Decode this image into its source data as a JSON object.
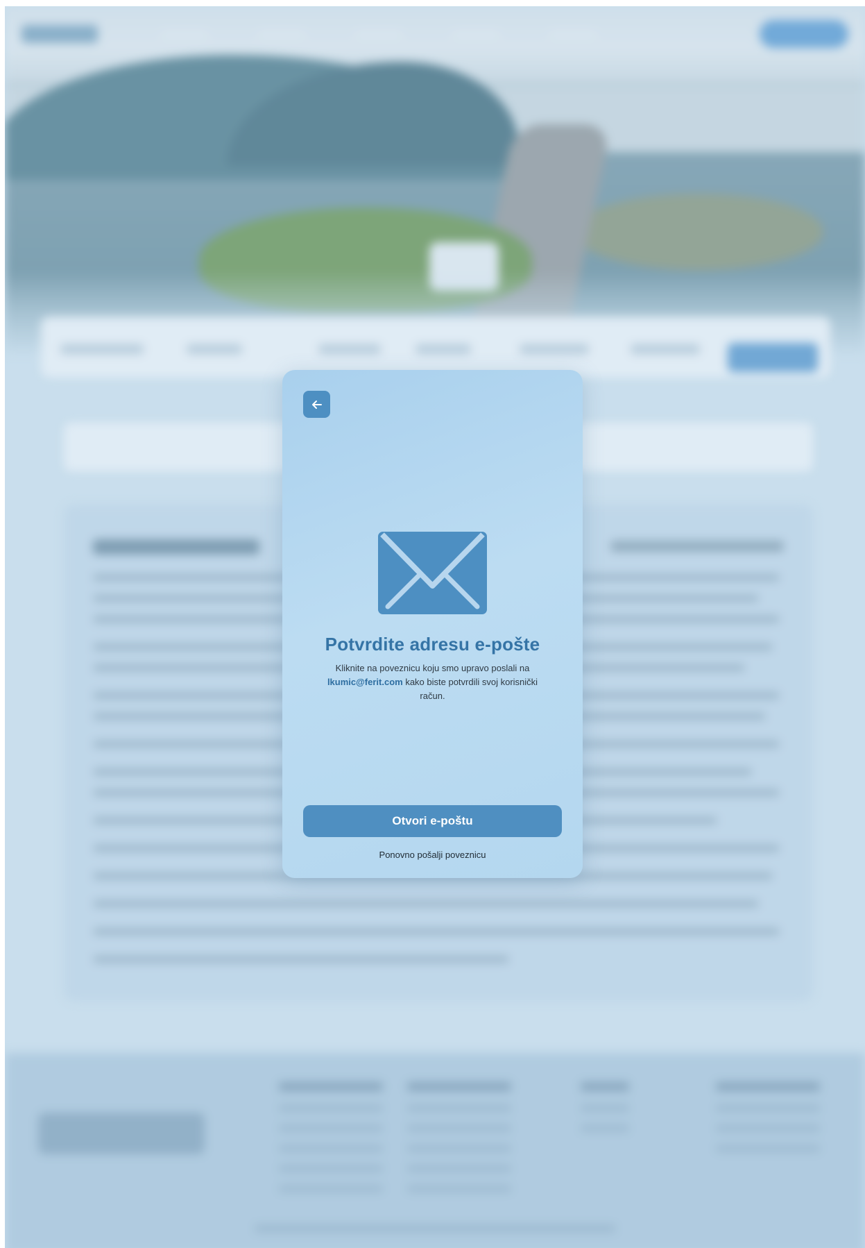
{
  "modal": {
    "title": "Potvrdite adresu e-pošte",
    "description_before": "Kliknite na poveznicu koju smo upravo poslali na",
    "email": "lkumic@ferit.com",
    "description_after": "kako biste potvrdili svoj korisnički račun.",
    "primary_button": "Otvori e-poštu",
    "resend_link": "Ponovno pošalji poveznicu",
    "back_icon": "arrow-left-icon",
    "mail_icon": "envelope-icon",
    "accent_color": "#4f8fc1",
    "heading_color": "#3574a6"
  }
}
